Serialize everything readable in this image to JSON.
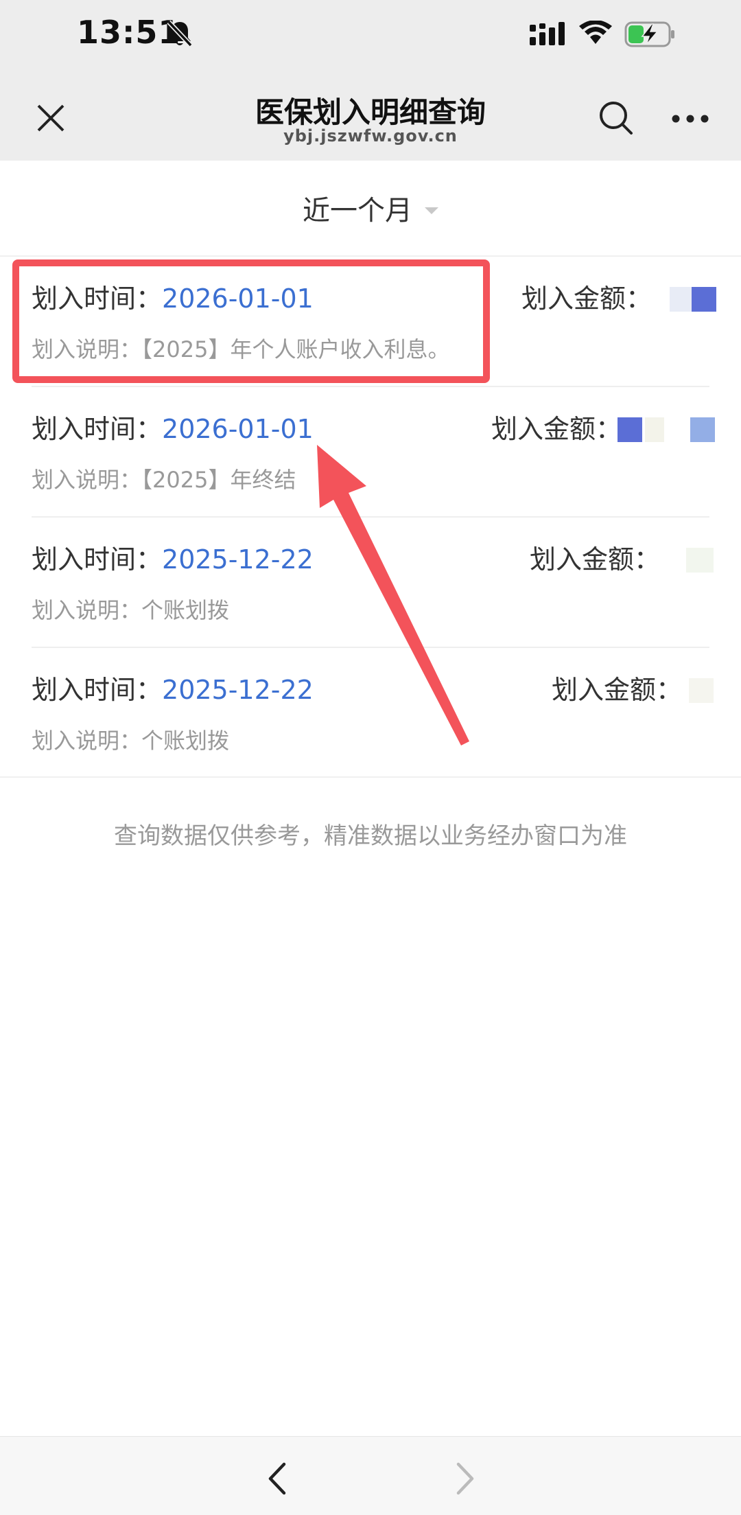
{
  "status_bar": {
    "time": "13:51"
  },
  "nav": {
    "title": "医保划入明细查询",
    "subtitle": "ybj.jszwfw.gov.cn"
  },
  "filter": {
    "selected": "近一个月"
  },
  "records": [
    {
      "time_label": "划入时间：",
      "time_value": "2026-01-01",
      "amount_label": "划入金额：",
      "desc_label": "划入说明：",
      "desc_value": "【2025】年个人账户收入利息。"
    },
    {
      "time_label": "划入时间：",
      "time_value": "2026-01-01",
      "amount_label": "划入金额：",
      "desc_label": "划入说明：",
      "desc_value": "【2025】年终结"
    },
    {
      "time_label": "划入时间：",
      "time_value": "2025-12-22",
      "amount_label": "划入金额：",
      "desc_label": "划入说明：",
      "desc_value": "个账划拨"
    },
    {
      "time_label": "划入时间：",
      "time_value": "2025-12-22",
      "amount_label": "划入金额：",
      "desc_label": "划入说明：",
      "desc_value": "个账划拨"
    }
  ],
  "footer": {
    "note": "查询数据仅供参考，精准数据以业务经办窗口为准"
  },
  "colors": {
    "accent_blue": "#3b6fd1",
    "highlight_red": "#f3535a",
    "muted_text": "#999999"
  },
  "icons": {
    "status": [
      "bell-off-icon",
      "cellular-signal-icon",
      "wifi-icon",
      "battery-charging-icon"
    ],
    "nav": [
      "close-icon",
      "search-icon",
      "more-icon"
    ],
    "bottom": [
      "chevron-left-icon",
      "chevron-right-icon"
    ]
  }
}
